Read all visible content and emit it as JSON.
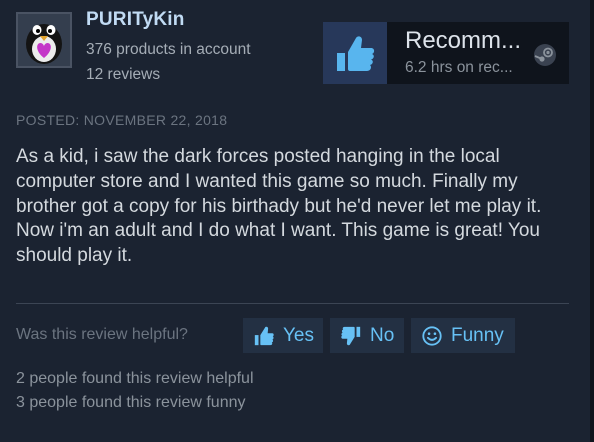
{
  "reviewer": {
    "username": "PURITyKin",
    "products": "376 products in account",
    "reviews": "12 reviews"
  },
  "recommendation": {
    "label": "Recomm...",
    "hours": "6.2 hrs on rec..."
  },
  "review": {
    "posted": "POSTED: NOVEMBER 22, 2018",
    "text": "As a kid, i saw the dark forces posted hanging in the local computer store and I wanted this game so much. Finally my brother got a copy for his birthady but he'd never let me play it. Now i'm an adult and I do what I want. This game is great! You should play it."
  },
  "feedback": {
    "question": "Was this review helpful?",
    "yes_label": "Yes",
    "no_label": "No",
    "funny_label": "Funny",
    "helpful_count": "2 people found this review helpful",
    "funny_count": "3 people found this review funny"
  },
  "colors": {
    "background": "#1b2331",
    "username": "#c1dbf4",
    "accent": "#67c1f5",
    "thumb": "#58b5ee"
  },
  "icons": {
    "avatar": "penguin-heart-avatar",
    "recommend": "thumbs-up-icon",
    "platform": "steam-logo-icon"
  }
}
